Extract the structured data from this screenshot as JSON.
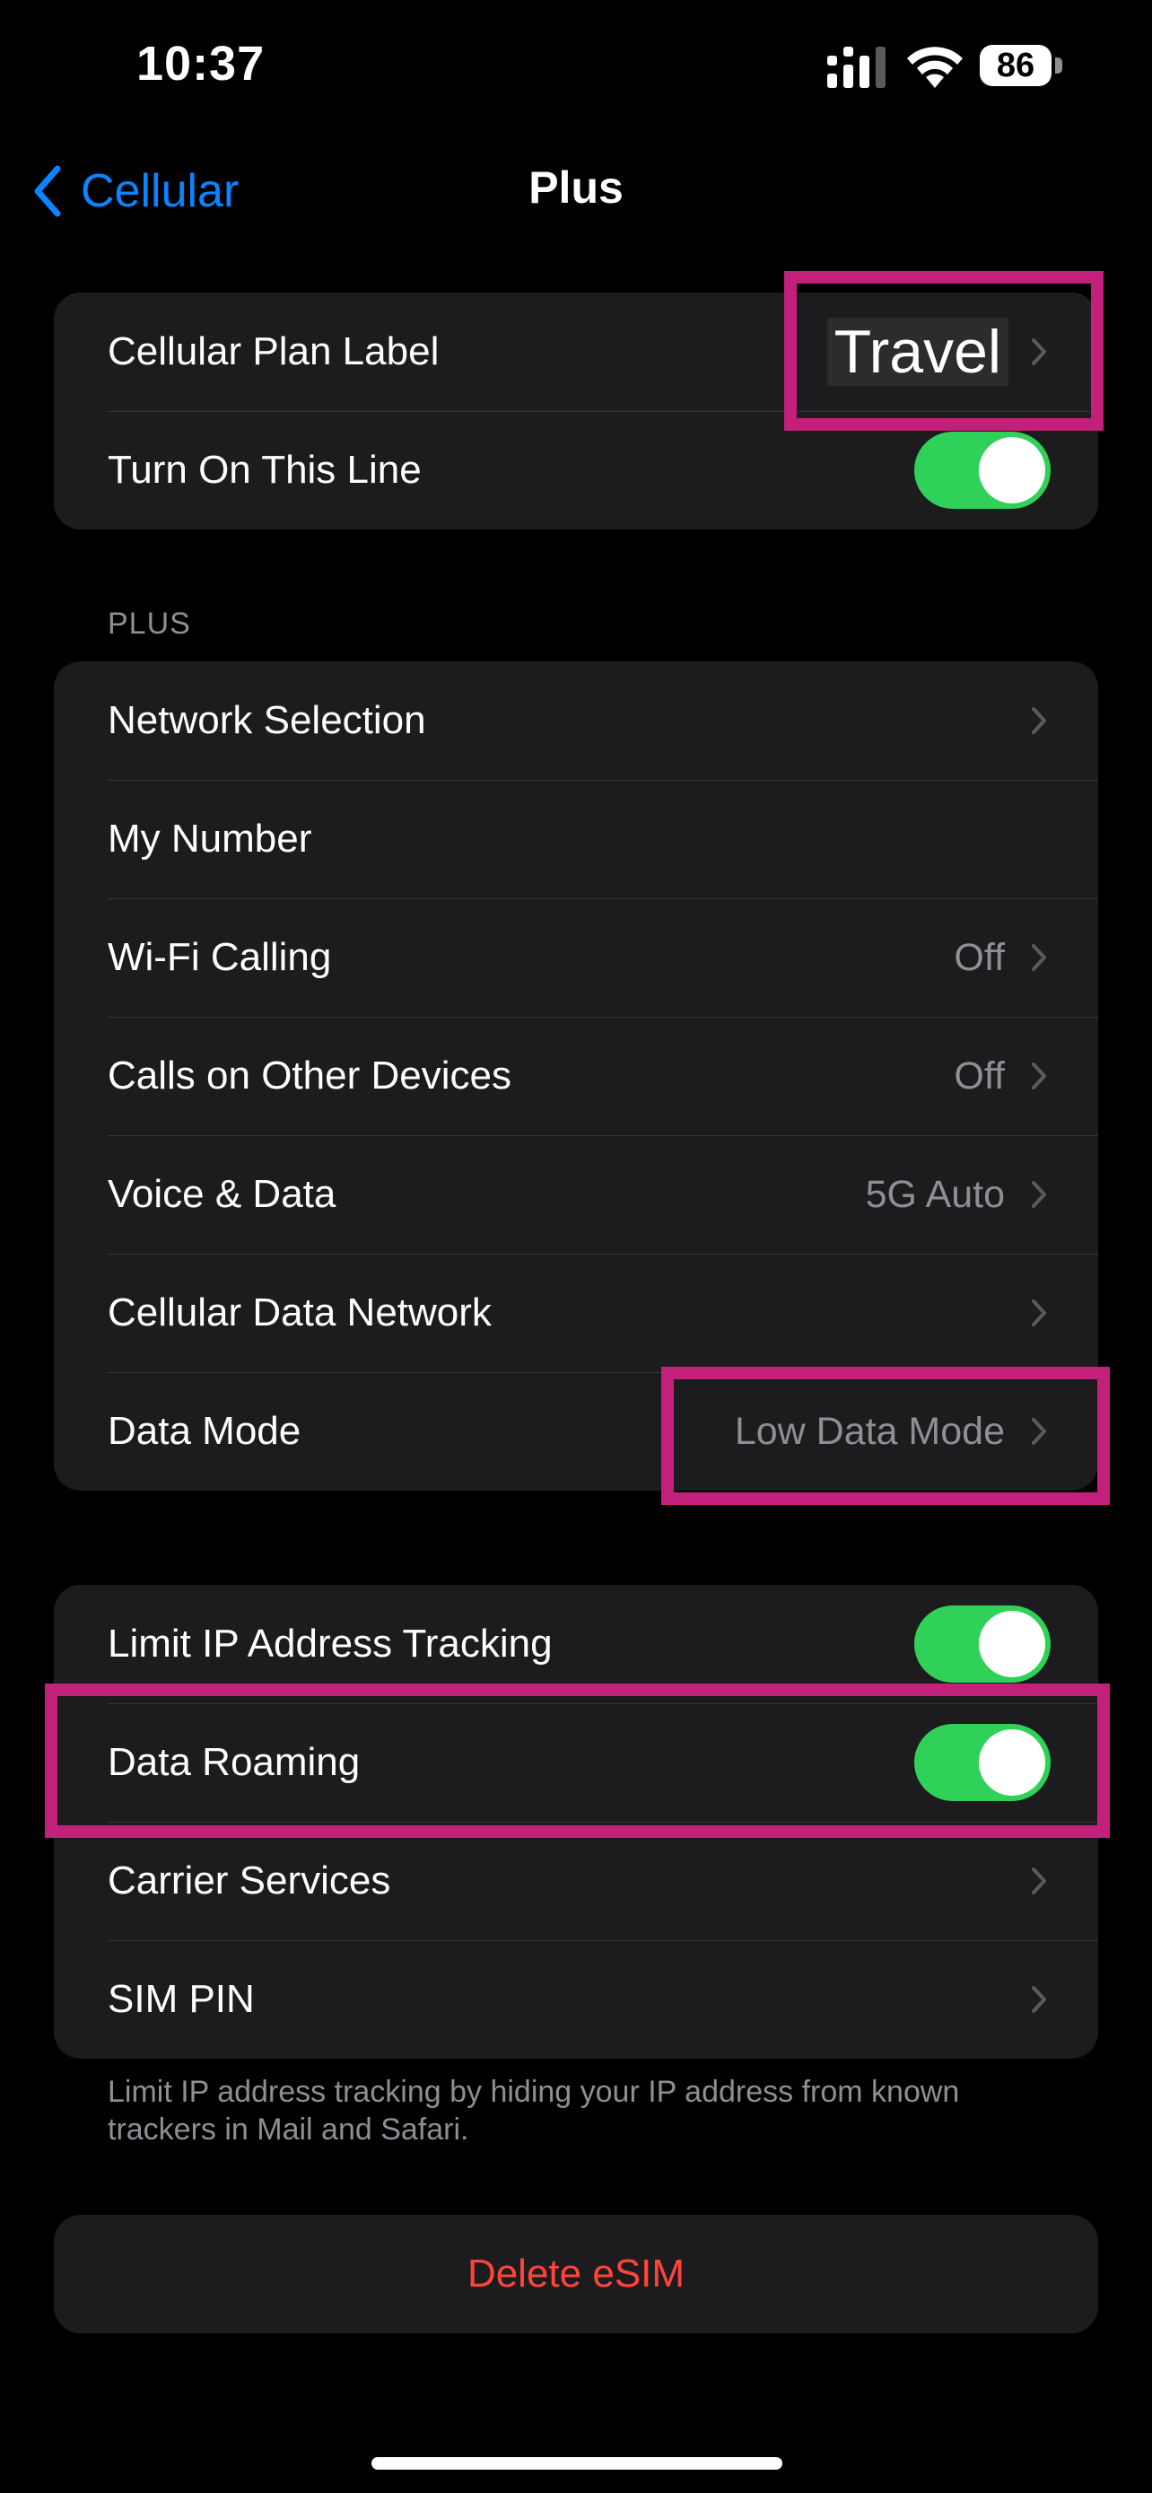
{
  "status_bar": {
    "time": "10:37",
    "battery_level": "86"
  },
  "nav": {
    "back_label": "Cellular",
    "title": "Plus"
  },
  "group_top": {
    "plan_label": "Cellular Plan Label",
    "plan_value": "Travel",
    "turn_on_line": "Turn On This Line",
    "turn_on_line_state": true
  },
  "section_header": "PLUS",
  "plus_group": {
    "network_selection": "Network Selection",
    "my_number": "My Number",
    "wifi_calling": "Wi-Fi Calling",
    "wifi_calling_value": "Off",
    "calls_other_devices": "Calls on Other Devices",
    "calls_other_devices_value": "Off",
    "voice_data": "Voice & Data",
    "voice_data_value": "5G Auto",
    "cellular_data_network": "Cellular Data Network",
    "data_mode": "Data Mode",
    "data_mode_value": "Low Data Mode"
  },
  "privacy_group": {
    "limit_ip": "Limit IP Address Tracking",
    "limit_ip_state": true,
    "data_roaming": "Data Roaming",
    "data_roaming_state": true,
    "carrier_services": "Carrier Services",
    "sim_pin": "SIM PIN"
  },
  "footer_note": "Limit IP address tracking by hiding your IP address from known trackers in Mail and Safari.",
  "delete_label": "Delete eSIM",
  "colors": {
    "accent_blue": "#0a84ff",
    "toggle_green": "#30d158",
    "destructive_red": "#ff453a",
    "highlight_magenta": "#c2207a"
  }
}
